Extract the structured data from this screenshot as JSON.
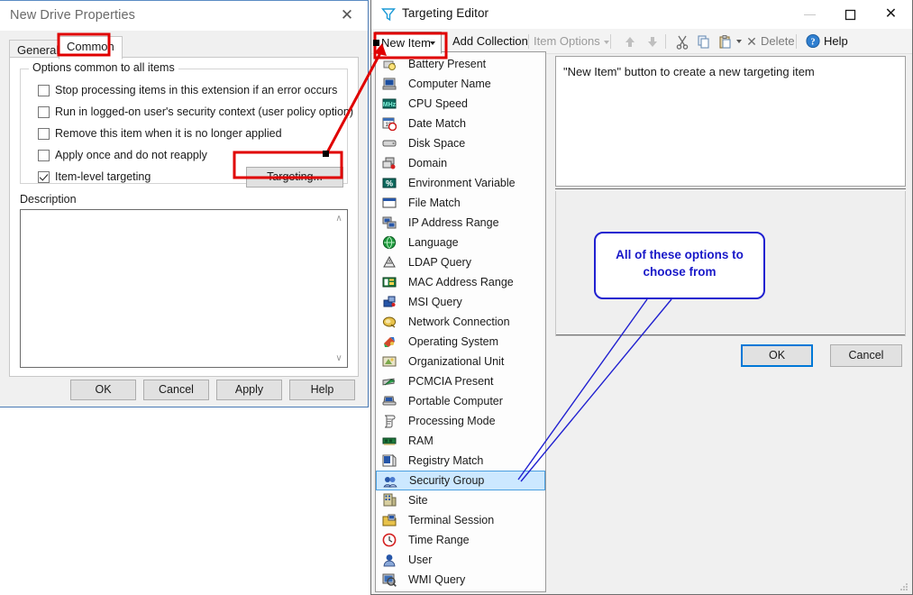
{
  "drive_dialog": {
    "title": "New Drive Properties",
    "close_label": "✕",
    "tabs": [
      {
        "label": "General",
        "selected": false
      },
      {
        "label": "Common",
        "selected": true
      }
    ],
    "group_legend": "Options common to all items",
    "checkboxes": [
      {
        "label": "Stop processing items in this extension if an error occurs",
        "checked": false
      },
      {
        "label": "Run in logged-on user's security context (user policy option)",
        "checked": false
      },
      {
        "label": "Remove this item when it is no longer applied",
        "checked": false
      },
      {
        "label": "Apply once and do not reapply",
        "checked": false
      },
      {
        "label": "Item-level targeting",
        "checked": true
      }
    ],
    "targeting_button": "Targeting...",
    "description_label": "Description",
    "description_value": "",
    "scroll_up": "∧",
    "scroll_down": "∨",
    "buttons": [
      {
        "label": "OK"
      },
      {
        "label": "Cancel"
      },
      {
        "label": "Apply"
      },
      {
        "label": "Help"
      }
    ]
  },
  "targeting_editor": {
    "title": "Targeting Editor",
    "window_icon": "funnel-icon",
    "window_controls": {
      "minimize": "—",
      "maximize": "☐",
      "close": "✕"
    },
    "toolbar": {
      "new_item": "New Item",
      "add_collection": "Add Collection",
      "item_options": "Item Options",
      "move_up": "move-up-icon",
      "move_down": "move-down-icon",
      "cut": "cut-icon",
      "copy": "copy-icon",
      "paste": "paste-icon",
      "delete": "Delete",
      "help": "Help"
    },
    "menu_items": [
      {
        "label": "Battery Present",
        "icon": "battery-icon",
        "selected": false
      },
      {
        "label": "Computer Name",
        "icon": "computer-icon",
        "selected": false
      },
      {
        "label": "CPU Speed",
        "icon": "mhz-icon",
        "selected": false
      },
      {
        "label": "Date Match",
        "icon": "calendar-clock-icon",
        "selected": false
      },
      {
        "label": "Disk Space",
        "icon": "drive-icon",
        "selected": false
      },
      {
        "label": "Domain",
        "icon": "domain-icon",
        "selected": false
      },
      {
        "label": "Environment Variable",
        "icon": "percent-icon",
        "selected": false
      },
      {
        "label": "File Match",
        "icon": "window-icon",
        "selected": false
      },
      {
        "label": "IP Address Range",
        "icon": "network-icon",
        "selected": false
      },
      {
        "label": "Language",
        "icon": "globe-icon",
        "selected": false
      },
      {
        "label": "LDAP Query",
        "icon": "ldap-icon",
        "selected": false
      },
      {
        "label": "MAC Address Range",
        "icon": "mac-icon",
        "selected": false
      },
      {
        "label": "MSI Query",
        "icon": "msi-icon",
        "selected": false
      },
      {
        "label": "Network Connection",
        "icon": "plug-icon",
        "selected": false
      },
      {
        "label": "Operating System",
        "icon": "os-icon",
        "selected": false
      },
      {
        "label": "Organizational Unit",
        "icon": "ou-icon",
        "selected": false
      },
      {
        "label": "PCMCIA Present",
        "icon": "pcmcia-icon",
        "selected": false
      },
      {
        "label": "Portable Computer",
        "icon": "laptop-icon",
        "selected": false
      },
      {
        "label": "Processing Mode",
        "icon": "scroll-icon",
        "selected": false
      },
      {
        "label": "RAM",
        "icon": "ram-icon",
        "selected": false
      },
      {
        "label": "Registry Match",
        "icon": "registry-icon",
        "selected": false
      },
      {
        "label": "Security Group",
        "icon": "group-icon",
        "selected": true
      },
      {
        "label": "Site",
        "icon": "site-icon",
        "selected": false
      },
      {
        "label": "Terminal Session",
        "icon": "terminal-icon",
        "selected": false
      },
      {
        "label": "Time Range",
        "icon": "clock-icon",
        "selected": false
      },
      {
        "label": "User",
        "icon": "user-icon",
        "selected": false
      },
      {
        "label": "WMI Query",
        "icon": "wmi-icon",
        "selected": false
      }
    ],
    "hint_text": "\"New Item\" button to create a new targeting item",
    "buttons": [
      {
        "label": "OK",
        "focused": true
      },
      {
        "label": "Cancel",
        "focused": false
      }
    ]
  },
  "annotations": {
    "callout_text_line1": "All of these options to",
    "callout_text_line2": "choose from",
    "callout_color": "#1818c8",
    "highlight_color": "#e00000",
    "highlighted_elements": [
      "Common",
      "Targeting...",
      "New Item"
    ]
  }
}
